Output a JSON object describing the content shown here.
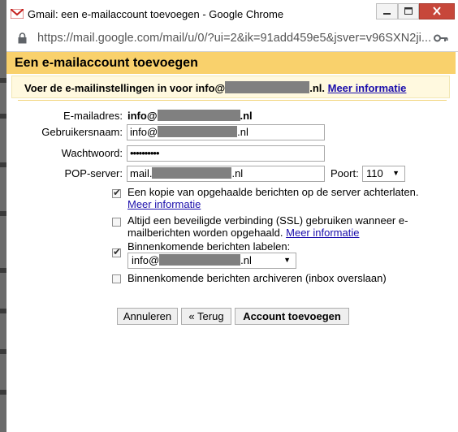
{
  "window": {
    "title": "Gmail: een e-mailaccount toevoegen - Google Chrome",
    "url": "https://mail.google.com/mail/u/0/?ui=2&ik=91add459e5&jsver=v96SXN2ji..."
  },
  "dialog": {
    "title": "Een e-mailaccount toevoegen",
    "intro_prefix": "Voer de e-mailinstellingen in voor info@",
    "intro_suffix": ".nl.",
    "more_info_link": "Meer informatie"
  },
  "form": {
    "email_label": "E-mailadres:",
    "email_prefix": "info@",
    "email_suffix": ".nl",
    "username_label": "Gebruikersnaam:",
    "username_prefix": "info@",
    "username_suffix": ".nl",
    "password_label": "Wachtwoord:",
    "password_value": "••••••••••",
    "pop_label": "POP-server:",
    "pop_prefix": "mail.",
    "pop_suffix": ".nl",
    "port_label": "Poort:",
    "port_value": "110"
  },
  "options": {
    "leave_copy": {
      "label": "Een kopie van opgehaalde berichten op de server achterlaten.",
      "link": "Meer informatie",
      "checked": true
    },
    "ssl": {
      "label_line1": "Altijd een beveiligde verbinding (SSL) gebruiken wanneer e-",
      "label_line2": "mailberichten worden opgehaald.",
      "link": "Meer informatie",
      "checked": false
    },
    "label_incoming": {
      "label": "Binnenkomende berichten labelen:",
      "select_prefix": "info@",
      "select_suffix": ".nl",
      "checked": true
    },
    "archive": {
      "label": "Binnenkomende berichten archiveren (inbox overslaan)",
      "checked": false
    }
  },
  "buttons": {
    "cancel": "Annuleren",
    "back": "« Terug",
    "add": "Account toevoegen"
  },
  "colors": {
    "dialog_header": "#f9d16c",
    "intro_background": "#fff9df",
    "link": "#1a0dab",
    "close_button": "#c7473a"
  }
}
